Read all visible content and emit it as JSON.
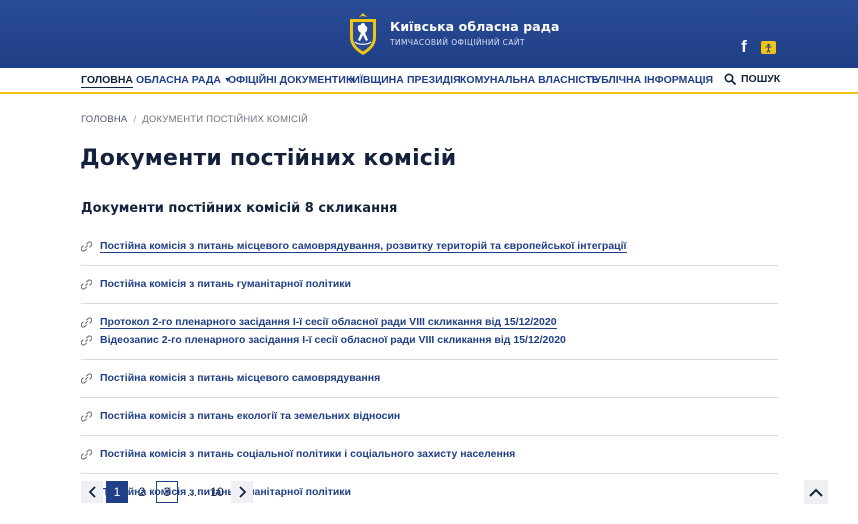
{
  "header": {
    "title": "Київська обласна рада",
    "subtitle": "ТИМЧАСОВИЙ ОФІЦІЙНИЙ САЙТ",
    "facebook_glyph": "f"
  },
  "nav": {
    "items": [
      {
        "label": "ГОЛОВНА",
        "active": true
      },
      {
        "label": "ОБЛАСНА РАДА",
        "has_dropdown": true
      },
      {
        "label": "ОФІЦІЙНІ ДОКУМЕНТИ",
        "has_dropdown": true
      },
      {
        "label": "КИЇВЩИНА"
      },
      {
        "label": "ПРЕЗИДІЯ"
      },
      {
        "label": "КОМУНАЛЬНА ВЛАСНІСТЬ"
      },
      {
        "label": "ПУБЛІЧНА ІНФОРМАЦІЯ"
      }
    ],
    "search_label": "ПОШУК",
    "caret": "▼"
  },
  "breadcrumb": {
    "home": "ГОЛОВНА",
    "separator": "/",
    "current": "ДОКУМЕНТИ ПОСТІЙНИХ КОМІСІЙ"
  },
  "page_title": "Документи постійних комісій",
  "section_title": "Документи постійних комісій 8 скликання",
  "documents": [
    [
      "Постійна комісія з питань місцевого самоврядування, розвитку територій та європейської інтеграції"
    ],
    [
      "Постійна комісія з питань гуманітарної політики"
    ],
    [
      "Протокол 2-го пленарного засідання І-ї сесії обласної ради VIII скликання від 15/12/2020",
      "Відеозапис 2-го пленарного засідання І-ї сесії обласної ради VIII скликання від 15/12/2020"
    ],
    [
      "Постійна комісія з питань місцевого самоврядування"
    ],
    [
      "Постійна комісія з питань екології та земельних відносин"
    ],
    [
      "Постійна комісія з питань соціальної політики і соціального захисту населення"
    ],
    [
      "Постійна комісія з питань гуманітарної політики"
    ]
  ],
  "pagination": {
    "pages": [
      "1",
      "2",
      "3",
      "...",
      "10"
    ],
    "current": "1"
  },
  "colors": {
    "brand_blue": "#1f3f86",
    "accent_yellow": "#f1c40f",
    "text_dark": "#14213d"
  }
}
